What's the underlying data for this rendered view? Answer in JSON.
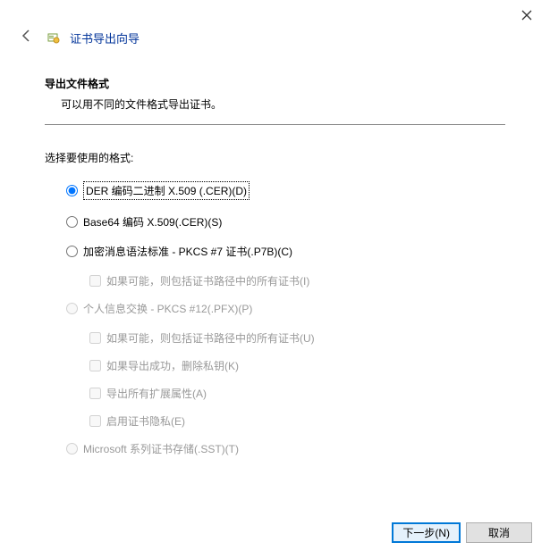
{
  "window": {
    "title": "证书导出向导"
  },
  "header": {
    "section_title": "导出文件格式",
    "section_desc": "可以用不同的文件格式导出证书。"
  },
  "format_prompt": "选择要使用的格式:",
  "options": {
    "der": "DER 编码二进制 X.509 (.CER)(D)",
    "base64": "Base64 编码 X.509(.CER)(S)",
    "pkcs7": "加密消息语法标准 - PKCS #7 证书(.P7B)(C)",
    "pkcs7_include": "如果可能，则包括证书路径中的所有证书(I)",
    "pfx": "个人信息交换 - PKCS #12(.PFX)(P)",
    "pfx_include": "如果可能，则包括证书路径中的所有证书(U)",
    "pfx_delete": "如果导出成功，删除私钥(K)",
    "pfx_export_ext": "导出所有扩展属性(A)",
    "pfx_enable_priv": "启用证书隐私(E)",
    "sst": "Microsoft 系列证书存储(.SST)(T)"
  },
  "buttons": {
    "next": "下一步(N)",
    "cancel": "取消"
  }
}
